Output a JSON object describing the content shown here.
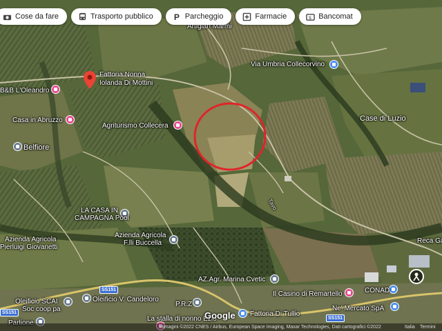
{
  "filters": [
    {
      "label": "Cose da fare",
      "icon": "camera-icon"
    },
    {
      "label": "Trasporto pubblico",
      "icon": "bus-icon"
    },
    {
      "label": "Parcheggio",
      "icon": "parking-icon"
    },
    {
      "label": "Farmacie",
      "icon": "pharmacy-icon"
    },
    {
      "label": "Bancomat",
      "icon": "atm-icon"
    }
  ],
  "places": {
    "fattoria_line1": "Fattoria Nonna",
    "fattoria_line2": "Iolanda Di Mottini",
    "bb_oleandro": "B&B L'Oleandro",
    "casa_abruzzo": "Casa in Abruzzo",
    "agriturismo": "Agriturismo Collecera",
    "belfiore": "Belfiore",
    "via_umbria": "Via Umbria Collecorvino",
    "case_di_luzio": "Case di Luzio",
    "artigian_marmi": "Artigian Marmi",
    "casa_campagna_line1": "LA CASA IN",
    "casa_campagna_line2": "CAMPAGNA Pool",
    "azienda_giovanetti_line1": "Azienda Agricola",
    "azienda_giovanetti_line2": "Pierluigi Giovanetti",
    "azienda_buccella_line1": "Azienda Agricola",
    "azienda_buccella_line2": "F.lli Buccella",
    "az_agr_marina": "AZ.Agr. Marina Cvetic",
    "oleificio_scai_line1": "Oleificio SCAI",
    "oleificio_scai_line2": "Soc coop pa",
    "oleificio_candeloro": "Oleificio V. Candeloro",
    "casino_remartello": "Il Casino di Remartello",
    "conad": "CONAD",
    "mercato": "Ne' Mercato SpA",
    "fattoria_tullio": "Fattoria Di Tullio",
    "stalla_nonno": "La stalla di nonno Ezio",
    "parlione": "Parlione",
    "prz": "P.R.Z",
    "reca": "Reca Ga",
    "ss151_a": "SS151",
    "ss151_b": "SS151",
    "ss151_c": "SS151",
    "road_tavo": "Tavo"
  },
  "google_logo": "Google",
  "attribution": {
    "imagery": "Immagini ©2022 CNES / Airbus, European Space Imaging, Maxar Technologies, Dati cartografici ©2022",
    "country": "Italia",
    "terms": "Termini"
  },
  "highlight": {
    "color": "#e0242a"
  },
  "colors": {
    "pin_red": "#ea4335",
    "poi_pink": "#e64a8f",
    "poi_blue": "#4a8ef0"
  }
}
